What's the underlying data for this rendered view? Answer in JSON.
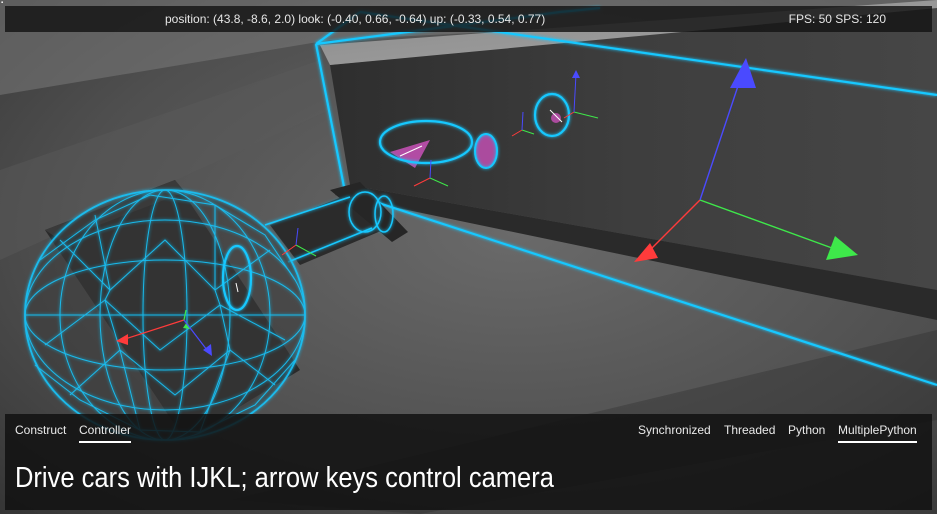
{
  "hud": {
    "camera_readout": "position: (43.8, -8.6, 2.0) look: (-0.40, 0.66, -0.64) up: (-0.33, 0.54, 0.77)",
    "fps_readout": "FPS: 50 SPS: 120"
  },
  "left_tabs": [
    {
      "label": "Construct",
      "active": false
    },
    {
      "label": "Controller",
      "active": true
    }
  ],
  "right_tabs": [
    {
      "label": "Synchronized",
      "active": false
    },
    {
      "label": "Threaded",
      "active": false
    },
    {
      "label": "Python",
      "active": false
    },
    {
      "label": "MultiplePython",
      "active": true
    }
  ],
  "instruction": "Drive cars with IJKL; arrow keys control camera",
  "colors": {
    "wireframe": "#19c8ff",
    "axis_x": "#ff3b3b",
    "axis_y": "#3ee84a",
    "axis_z": "#4a4aff",
    "joint_fill": "#c04fb0"
  },
  "icons": [
    "corner-marker-icon"
  ]
}
